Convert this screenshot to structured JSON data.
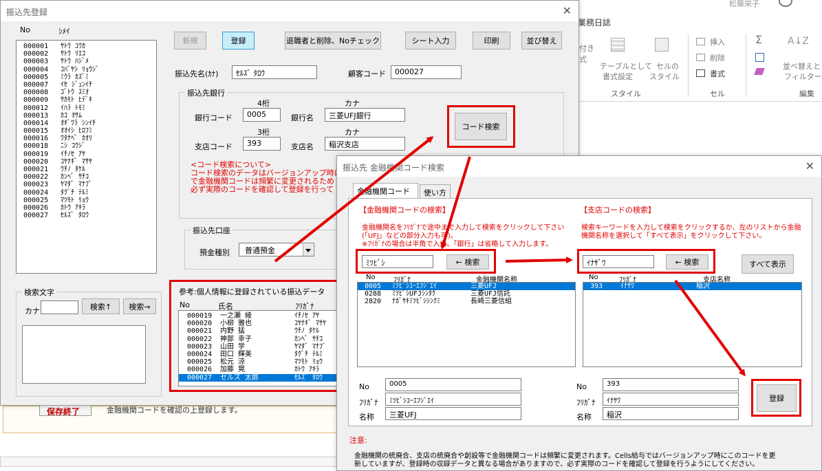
{
  "colors": {
    "accent": "#0078d7",
    "annotation": "#e00000"
  },
  "ribbon": {
    "title": "業務日誌",
    "user": "松藤栄子",
    "insert": "挿入",
    "delete": "削除",
    "format": "書式",
    "table_format": "テーブルとして",
    "table_format2": "書式設定",
    "cell_style": "セルの",
    "cell_style2": "スタイル",
    "cond": "付き",
    "cond2": "式",
    "sort": "並べ替えと",
    "sort2": "フィルター",
    "group_style": "スタイル",
    "group_cell": "セル",
    "group_edit": "編集"
  },
  "sheet": {
    "lower_text": "保存終了",
    "lower_note": "金融機関コードを確認の上登録します。"
  },
  "main": {
    "title": "振込先登録",
    "list_header_no": "No",
    "list_header_kana": "ｼﾒｲ",
    "list": [
      {
        "no": "000001",
        "kana": "ｻﾄｳ ﾕｳｶ"
      },
      {
        "no": "000002",
        "kana": "ｻﾄｳ ﾘｴｺ"
      },
      {
        "no": "000003",
        "kana": "ｻﾄｳ ﾊｼﾞﾒ"
      },
      {
        "no": "000004",
        "kana": "ｺﾊﾞﾔｼ ﾘｮｳｼﾞ"
      },
      {
        "no": "000005",
        "kana": "ﾐｳﾗ ｶｽﾞﾐ"
      },
      {
        "no": "000007",
        "kana": "ｲｾ ｼﾞｭﾝｲﾁ"
      },
      {
        "no": "000008",
        "kana": "ｺﾞﾄｳ ｽﾐｵ"
      },
      {
        "no": "000009",
        "kana": "ｻｶﾓﾄ ﾋﾃﾞｷ"
      },
      {
        "no": "000012",
        "kana": "ｲﾊﾗ ﾄﾓﾐ"
      },
      {
        "no": "000013",
        "kana": "ｶｺ ｵｻﾑ"
      },
      {
        "no": "000014",
        "kana": "ｵｷﾞﾜﾗ ｼﾝｲﾁ"
      },
      {
        "no": "000015",
        "kana": "ｵｵｲｼ ﾋﾛﾌﾐ"
      },
      {
        "no": "000016",
        "kana": "ﾜﾀﾅﾍﾞ ｶｵﾘ"
      },
      {
        "no": "000018",
        "kana": "ﾆｼ ｺｳｼﾞ"
      },
      {
        "no": "000019",
        "kana": "ｲﾁﾉｾ ｱﾔ"
      },
      {
        "no": "000020",
        "kana": "ｺﾔﾅｷﾞ ﾏｻﾔ"
      },
      {
        "no": "000021",
        "kana": "ｳﾁﾉ ﾀｹﾙ"
      },
      {
        "no": "000022",
        "kana": "ｶﾝﾍﾞ ｻﾁｺ"
      },
      {
        "no": "000023",
        "kana": "ﾔﾏﾀﾞ ﾏﾅﾌﾞ"
      },
      {
        "no": "000024",
        "kana": "ﾀｸﾞﾁ ﾃﾙﾐ"
      },
      {
        "no": "000025",
        "kana": "ﾏﾂﾓﾄ ﾘｮｳ"
      },
      {
        "no": "000026",
        "kana": "ｶﾄｳ ｱｷﾗ"
      },
      {
        "no": "000027",
        "kana": "ｾﾙｽﾞ ﾀﾛｳ"
      }
    ],
    "btn_new": "新規",
    "btn_register": "登録",
    "btn_delete_retired": "退職者と削除、Noチェック",
    "btn_sheet_input": "シート入力",
    "btn_print": "印刷",
    "btn_sort": "並び替え",
    "payee_name_label": "振込先名(ｶﾅ)",
    "payee_name": "ｾﾙｽﾞ ﾀﾛｳ",
    "customer_code_label": "顧客コード",
    "customer_code": "000027",
    "bank_group": "振込先銀行",
    "digits4": "4桁",
    "digits3": "3桁",
    "kana": "カナ",
    "bank_code_label": "銀行コード",
    "bank_code": "0005",
    "bank_name_label": "銀行名",
    "bank_name": "三菱UFJ銀行",
    "branch_code_label": "支店コード",
    "branch_code": "393",
    "branch_name_label": "支店名",
    "branch_name": "稲沢支店",
    "btn_code_search": "コード検索",
    "notice_title": "<コード検索について>",
    "notice_l1": "コード検索のデータはバージョンアップ時に更",
    "notice_l2": "で金融機関コードは頻繁に変更されるため",
    "notice_l3": "必ず実際のコードを確認して登録を行って",
    "account_group": "振込先口座",
    "deposit_type_label": "預金種別",
    "deposit_type": "普通預金",
    "search_group": "検索文字",
    "search_kana_label": "カナ",
    "search_kana": "",
    "btn_search_up": "検索↑",
    "btn_search_right": "検索→",
    "ref_title": "参考:個人情報に登録されている振込データ",
    "ref_h_no": "No",
    "ref_h_name": "氏名",
    "ref_h_kana": "ﾌﾘｶﾞﾅ",
    "ref_rows": [
      {
        "no": "000019",
        "name": "一之瀬 綾",
        "kana": "ｲﾁﾉｾ ｱﾔ"
      },
      {
        "no": "000020",
        "name": "小柳 雅也",
        "kana": "ｺﾔﾅｷﾞ ﾏｻﾔ"
      },
      {
        "no": "000021",
        "name": "内野 猛",
        "kana": "ｳﾁﾉ ﾀｹﾙ"
      },
      {
        "no": "000022",
        "name": "神部 幸子",
        "kana": "ｶﾝﾍﾞ ｻﾁｺ"
      },
      {
        "no": "000023",
        "name": "山田 学",
        "kana": "ﾔﾏﾀﾞ ﾏﾅﾌﾞ"
      },
      {
        "no": "000024",
        "name": "田口 輝美",
        "kana": "ﾀｸﾞﾁ ﾃﾙﾐ"
      },
      {
        "no": "000025",
        "name": "松元 涼",
        "kana": "ﾏﾂﾓﾄ ﾘｮｳ"
      },
      {
        "no": "000026",
        "name": "加藤 晃",
        "kana": "ｶﾄｳ ｱｷﾗ"
      },
      {
        "no": "000027",
        "name": "セルズ 太郎",
        "kana": "ｾﾙｽﾞ ﾀﾛｳ"
      }
    ]
  },
  "search": {
    "title": "振込先 金融機関コード検索",
    "tab1": "金融機関コード検索",
    "tab2": "使い方",
    "bank_section": "【金融機関コードの検索】",
    "bank_help1": "金融機関名をﾌﾘｶﾞﾅで途中まで入力して検索をクリックして下さい",
    "bank_help2": "(「UFJ」などの部分入力も可)。",
    "bank_help3": "※ﾌﾘｶﾞﾅの場合は半角で入力。「銀行」は省略して入力します。",
    "bank_query": "ﾐﾂﾋﾞｼ",
    "btn_bank_search": "← 検索",
    "bank_h_no": "No",
    "bank_h_kana": "ﾌﾘｶﾞﾅ",
    "bank_h_name": "金融機関名称",
    "bank_rows": [
      {
        "no": "0005",
        "kana": "ﾐﾂﾋﾞｼﾕｰｴﾌｼﾞｴｲ",
        "name": "三菱UFJ"
      },
      {
        "no": "0288",
        "kana": "ﾐﾂﾋﾞｼUFJｼﾝﾀｸ",
        "name": "三菱UFJ信託"
      },
      {
        "no": "2820",
        "kana": "ﾅｶﾞｻｷﾐﾂﾋﾞｼｼﾝｸﾐ",
        "name": "長崎三菱信組"
      }
    ],
    "branch_section": "【支店コードの検索】",
    "branch_help1": "検索キーワードを入力して検索をクリックするか、左のリストから金融",
    "branch_help2": "機関名称を選択して「すべて表示」をクリックして下さい。",
    "branch_query": "ｲﾅｻﾞﾜ",
    "btn_branch_search": "← 検索",
    "btn_show_all": "すべて表示",
    "branch_h_no": "No",
    "branch_h_kana": "ﾌﾘｶﾞﾅ",
    "branch_h_name": "支店名称",
    "branch_rows": [
      {
        "no": "393",
        "kana": "ｲﾅｻﾜ",
        "name": "稲沢"
      }
    ],
    "no_label": "No",
    "kana_label": "ﾌﾘｶﾞﾅ",
    "name_label": "名称",
    "sel_bank_no": "0005",
    "sel_bank_kana": "ﾐﾂﾋﾞｼﾕｰｴﾌｼﾞｴｲ",
    "sel_bank_name": "三菱UFJ",
    "sel_branch_no": "393",
    "sel_branch_kana": "ｲﾅｻﾜ",
    "sel_branch_name": "稲沢",
    "btn_register": "登録",
    "note_title": "注意:",
    "note_l1": "金融機関の統廃合、支店の統廃合や創設等で金融機関コードは頻繁に変更されます。Cells給与ではバージョンアップ時にこのコードを更",
    "note_l2": "新していますが、登録時の収録データと異なる場合がありますので、必ず実際のコードを確認して登録を行うようにしてください。"
  }
}
